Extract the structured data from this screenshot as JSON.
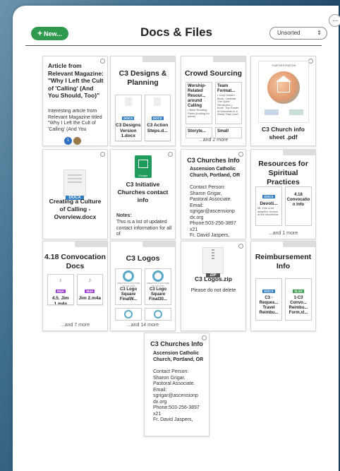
{
  "header": {
    "new_label": "New...",
    "title": "Docs & Files",
    "sort_value": "Unsorted",
    "corner_label": "..."
  },
  "cards": {
    "article": {
      "title": "Article from Relevant Magazine: \"Why I Left the Cult of 'Calling' (And You Should, Too)\"",
      "body": "Interesting article from Relevant Magazine titled \"Why I Left the Cult of 'Calling' (And You",
      "count": "1"
    },
    "c3designs": {
      "title": "C3 Designs & Planning",
      "items": [
        {
          "badge": "DOCX",
          "label": "C3 Designs Version 1.docx"
        },
        {
          "badge": "DOCX",
          "label": "C3 Action Steps.d..."
        }
      ]
    },
    "crowd": {
      "title": "Crowd Sourcing",
      "items": [
        {
          "label": "Worship-Related Resour... around Calling",
          "sub": "• Bible Reading Plans (looking for some)"
        },
        {
          "label": "Team Format...",
          "sub": "• Cory Holden - Book • website: The Quiet Revolution • book: The Power of Introverts in a World That Can't"
        },
        {
          "label": "Storyte...",
          "sub": ""
        },
        {
          "label": "Small",
          "sub": ""
        }
      ],
      "more": "...and 2 more"
    },
    "churchinfo": {
      "title": "C3 Church info sheet .pdf",
      "poster_title": "YOUR DESTINATION",
      "poster_sub": "C3 Calling"
    },
    "culture": {
      "badge": "DOCX",
      "title": "Creating a Culture of Calling - Overview.docx"
    },
    "initiative": {
      "logo": "Google",
      "title": "C3 Initiative Churches contact info",
      "notes_label": "Notes:",
      "notes": "This is a list of updated contact information for all of"
    },
    "churches1": {
      "title": "C3 Churches Info",
      "church": "Ascension Catholic Church, Portland, OR",
      "lines": [
        "Contact Person:",
        "Sharon Grigar,",
        "Pastoral Associate.",
        "Email:",
        "sgrigar@ascensionp",
        "dx.org",
        "Phone:503-256-3897",
        "x21",
        "Fr. David Jaspers,"
      ]
    },
    "resources": {
      "title": "Resources for Spiritual Practices",
      "items": [
        {
          "badge": "DOCX",
          "label": "Devoti...",
          "sub": "Mr. Grin a bit adaptive version of the devotional"
        },
        {
          "label": "4.18 Convocatio n Info",
          "sub": ""
        }
      ],
      "more": "...and 1 more"
    },
    "convocation": {
      "title": "4.18 Convocation Docs",
      "items": [
        {
          "badge": "M4A",
          "label": "4.5. Jim 1.m4a"
        },
        {
          "badge": "M4A",
          "label": "Jim 2.m4a"
        }
      ],
      "more": "...and 7 more"
    },
    "logos": {
      "title": "C3 Logos",
      "items": [
        {
          "label": "C3 Logo Square FinalW..."
        },
        {
          "label": "C3 Logo Square Final30..."
        }
      ],
      "tiny_label": "CREATING A CULTURE OF CALLING",
      "more": "...and 14 more"
    },
    "logoszip": {
      "badge": "ZIP",
      "title": "C3 Logos.zip",
      "body": "Please do not delete"
    },
    "reimbursement": {
      "title": "Reimbursement Info",
      "items": [
        {
          "badge": "DOCX",
          "label": "C3 - Reques... Travel Reimbu..."
        },
        {
          "badge": "XLSX",
          "label": "1-C3 Convo... Reimbu... Form.xl..."
        }
      ]
    },
    "churches2": {
      "title": "C3 Churches Info",
      "church": "Ascension Catholic Church, Portland, OR",
      "lines": [
        "Contact Person:",
        "Sharon Grigar,",
        "Pastoral Associate.",
        "Email:",
        "sgrigar@ascensionp",
        "dx.org",
        "Phone:503-256-3897",
        "x21",
        "Fr. David Jaspers,"
      ]
    }
  }
}
